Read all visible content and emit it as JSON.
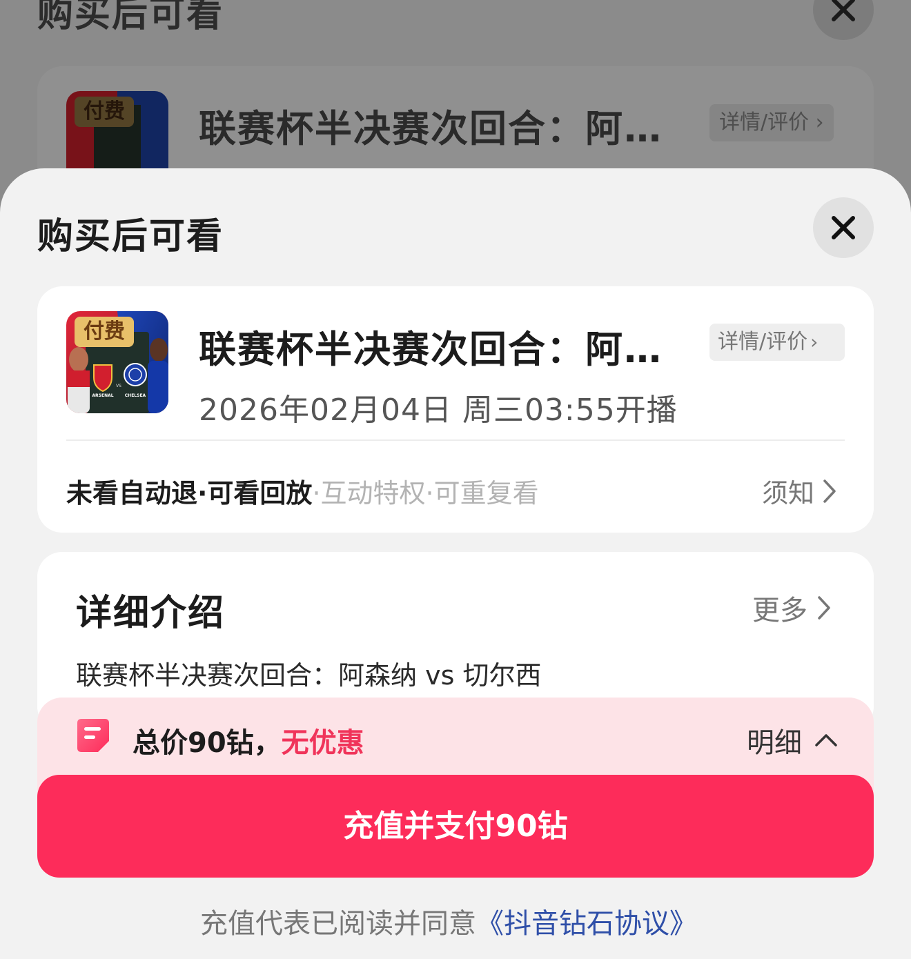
{
  "background_sheet": {
    "title": "购买后可看",
    "product_title": "联赛杯半决赛次回合：阿…",
    "detail_label": "详情/评价"
  },
  "sheet": {
    "title": "购买后可看"
  },
  "product": {
    "badge": "付费",
    "title": "联赛杯半决赛次回合：阿…",
    "detail_label": "详情/评价",
    "time": "2026年02月04日 周三03:55开播",
    "thumb_home_label": "ARSENAL",
    "thumb_vs": "VS",
    "thumb_away_label": "CHELSEA"
  },
  "features": {
    "strong_text": "未看自动退·可看回放",
    "weak_text": "·互动特权·可重复看",
    "notice_label": "须知"
  },
  "intro": {
    "title": "详细介绍",
    "more_label": "更多",
    "text": "联赛杯半决赛次回合：阿森纳 vs 切尔西"
  },
  "price": {
    "total_text": "总价90钻，",
    "discount_text": "无优惠",
    "breakdown_label": "明细"
  },
  "pay_button": {
    "label": "充值并支付90钻"
  },
  "agreement": {
    "prefix": "充值代表已阅读并同意",
    "link_text": "《抖音钻石协议》"
  },
  "colors": {
    "accent": "#fd2c5a",
    "highlight": "#f0345a",
    "link": "#2f4fa8",
    "badge": "#e8c06a"
  }
}
